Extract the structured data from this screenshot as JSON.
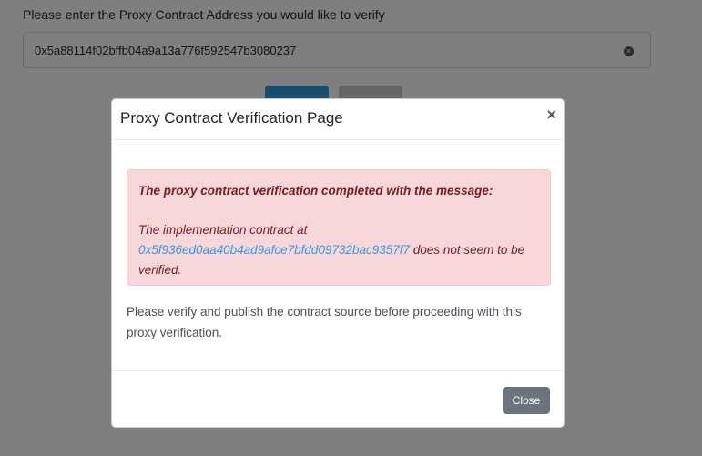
{
  "background": {
    "prompt_label": "Please enter the Proxy Contract Address you would like to verify",
    "address_value": "0x5a88114f02bffb04a9a13a776f592547b3080237",
    "clear_icon": "×"
  },
  "modal": {
    "title": "Proxy Contract Verification Page",
    "close_icon": "×",
    "alert": {
      "heading": "The proxy contract verification completed with the message:",
      "message_prefix": "The implementation contract at",
      "implementation_address": "0x5f936ed0aa40b4ad9afce7bfdd09732bac9357f7",
      "message_suffix": "does not seem to be verified."
    },
    "body_text": "Please verify and publish the contract source before proceeding with this proxy verification.",
    "close_button_label": "Close"
  },
  "colors": {
    "alert_bg": "#f8d7da",
    "alert_text": "#721c24",
    "link": "#3498db",
    "close_button": "#6c757d"
  }
}
